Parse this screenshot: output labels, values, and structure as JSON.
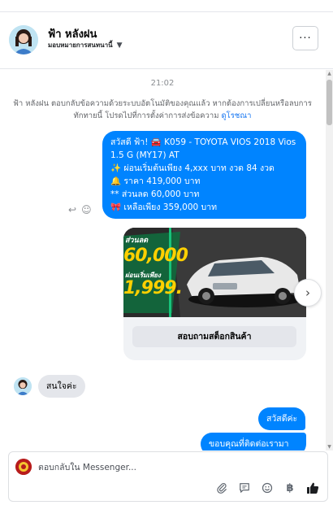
{
  "header": {
    "name": "ฟ้า หลังฝน",
    "assign_label": "มอบหมายการสนทนานี้",
    "more_label": "···"
  },
  "chat": {
    "time": "21:02",
    "notice": "ฟ้า หลังฝน ตอบกลับข้อความด้วยระบบอัตโนมัติของคุณแล้ว หากต้องการเปลี่ยนหรือลบการทักทายนี้ โปรดไปที่การตั้งค่าการส่งข้อความ",
    "notice_link": "ดูโรชณา",
    "message1_lines": [
      "สวัสดี ฟ้า! 🚘 K059 - TOYOTA VIOS 2018 Vios",
      "1.5 G (MY17) AT",
      "✨ ผ่อนเริ่มต้นเพียง 4,xxx บาท งวด 84 งวด",
      "🔔 ราคา 419,000 บาท",
      "** ส่วนลด 60,000 บาท",
      "🎀 เหลือเพียง 359,000 บาท"
    ],
    "card": {
      "promo_discount": "ส่วนลด",
      "promo_amount": "60,000",
      "promo_install": "ผ่อนเริ่มเพียง",
      "promo_install_amount": "1,999.",
      "button_label": "สอบถามสต็อกสินค้า"
    },
    "reply_in": "สนใจค่ะ",
    "message2": "สวัสดีค่ะ",
    "message3": "ขอบคุณที่ติดต่อเรามา"
  },
  "composer": {
    "placeholder": "ตอบกลับใน Messenger..."
  },
  "icons": {
    "more": "more-horizontal-icon",
    "reply": "reply-icon",
    "react": "smile-icon",
    "next": "chevron-right-icon",
    "attach": "paperclip-icon",
    "saved_replies": "message-square-icon",
    "emoji": "emoji-icon",
    "payment": "baht-icon",
    "like": "thumbs-up-icon"
  },
  "colors": {
    "accent": "#0084ff",
    "like": "#1877f2",
    "bubble_in": "#e4e6eb"
  }
}
